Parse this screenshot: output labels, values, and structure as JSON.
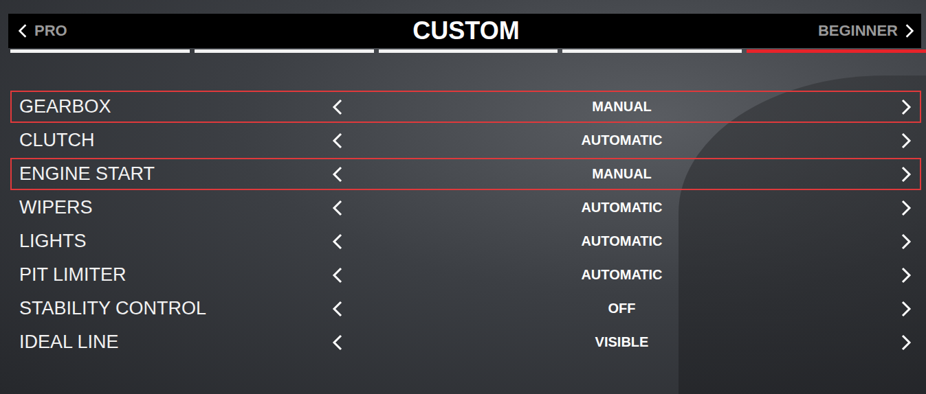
{
  "header": {
    "prev": "PRO",
    "title": "CUSTOM",
    "next": "BEGINNER"
  },
  "segments": [
    {
      "selected": false
    },
    {
      "selected": false
    },
    {
      "selected": false
    },
    {
      "selected": false
    },
    {
      "selected": true
    }
  ],
  "settings": [
    {
      "label": "GEARBOX",
      "value": "MANUAL",
      "highlighted": true
    },
    {
      "label": "CLUTCH",
      "value": "AUTOMATIC",
      "highlighted": false
    },
    {
      "label": "ENGINE START",
      "value": "MANUAL",
      "highlighted": true
    },
    {
      "label": "WIPERS",
      "value": "AUTOMATIC",
      "highlighted": false
    },
    {
      "label": "LIGHTS",
      "value": "AUTOMATIC",
      "highlighted": false
    },
    {
      "label": "PIT LIMITER",
      "value": "AUTOMATIC",
      "highlighted": false
    },
    {
      "label": "STABILITY CONTROL",
      "value": "OFF",
      "highlighted": false
    },
    {
      "label": "IDEAL LINE",
      "value": "VISIBLE",
      "highlighted": false
    }
  ]
}
